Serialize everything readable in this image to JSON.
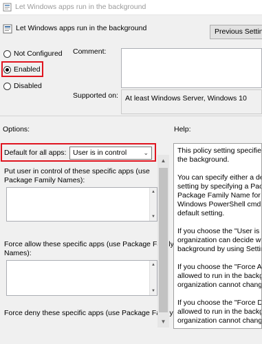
{
  "window": {
    "title": "Let Windows apps run in the background"
  },
  "header": {
    "title": "Let Windows apps run in the background",
    "previous_button": "Previous Setting"
  },
  "state": {
    "options": [
      {
        "label": "Not Configured",
        "selected": false
      },
      {
        "label": "Enabled",
        "selected": true
      },
      {
        "label": "Disabled",
        "selected": false
      }
    ]
  },
  "comment": {
    "label": "Comment:",
    "value": ""
  },
  "supported": {
    "label": "Supported on:",
    "value": "At least Windows Server, Windows 10"
  },
  "options": {
    "label": "Options:",
    "default_label": "Default for all apps:",
    "default_value": "User is in control",
    "user_control_label_1": "Put user in control of these specific apps (use",
    "user_control_label_2": "Package Family Names):",
    "force_allow_label_1": "Force allow these specific apps (use Package Family",
    "force_allow_label_2": "Names):",
    "force_deny_label": "Force deny these specific apps (use Package Family"
  },
  "help": {
    "label": "Help:",
    "lines": [
      "This policy setting specifies w",
      "the background.",
      "",
      "You can specify either a defau",
      "setting by specifying a Packag",
      "Package Family Name for an",
      "Windows PowerShell cmdlet.",
      "default setting.",
      "",
      "If you choose the \"User is in c",
      "organization can decide whet",
      "background by using Settings",
      "",
      "If you choose the \"Force Allow",
      "allowed to run in the backgro",
      "organization cannot change i",
      "",
      "If you choose the \"Force Deny",
      "allowed to run in the backgro",
      "organization cannot change i"
    ]
  },
  "colors": {
    "highlight": "#e0131e",
    "background": "#f0f0f0"
  },
  "icons": {
    "window": "policy-setting-icon",
    "header": "policy-setting-icon"
  }
}
